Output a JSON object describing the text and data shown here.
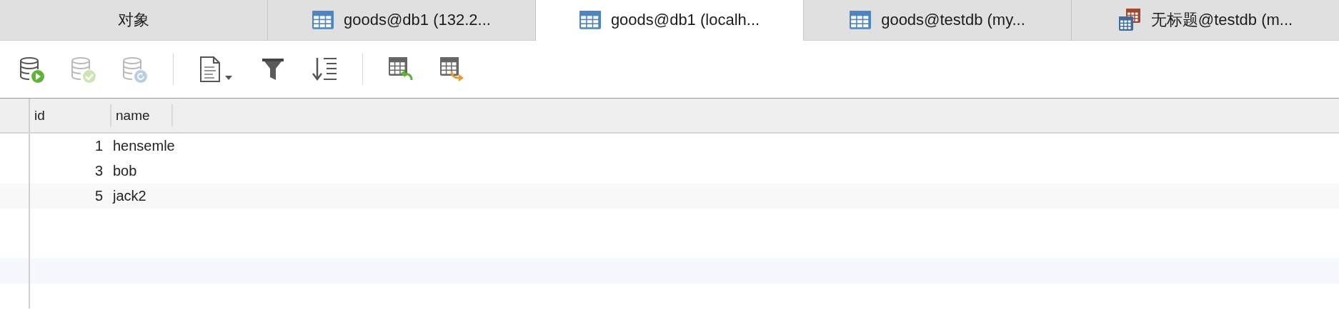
{
  "tabs": [
    {
      "label": "对象",
      "kind": "plain",
      "selected": false
    },
    {
      "label": "goods@db1 (132.2...",
      "kind": "table",
      "selected": false
    },
    {
      "label": "goods@db1 (localh...",
      "kind": "table",
      "selected": true
    },
    {
      "label": "goods@testdb (my...",
      "kind": "table",
      "selected": false
    },
    {
      "label": "无标题@testdb (m...",
      "kind": "query",
      "selected": false
    }
  ],
  "toolbar": [
    {
      "kind": "db-run",
      "disabled": false
    },
    {
      "kind": "db-check",
      "disabled": true
    },
    {
      "kind": "db-refresh",
      "disabled": true
    },
    {
      "kind": "separator"
    },
    {
      "kind": "document",
      "disabled": false
    },
    {
      "kind": "filter",
      "disabled": false
    },
    {
      "kind": "sort",
      "disabled": false
    },
    {
      "kind": "separator"
    },
    {
      "kind": "table-import",
      "disabled": false
    },
    {
      "kind": "table-export",
      "disabled": false
    }
  ],
  "table": {
    "columns": [
      "id",
      "name"
    ],
    "rows": [
      {
        "id": "1",
        "name": "hensemle"
      },
      {
        "id": "3",
        "name": "bob"
      },
      {
        "id": "5",
        "name": "jack2"
      }
    ]
  }
}
